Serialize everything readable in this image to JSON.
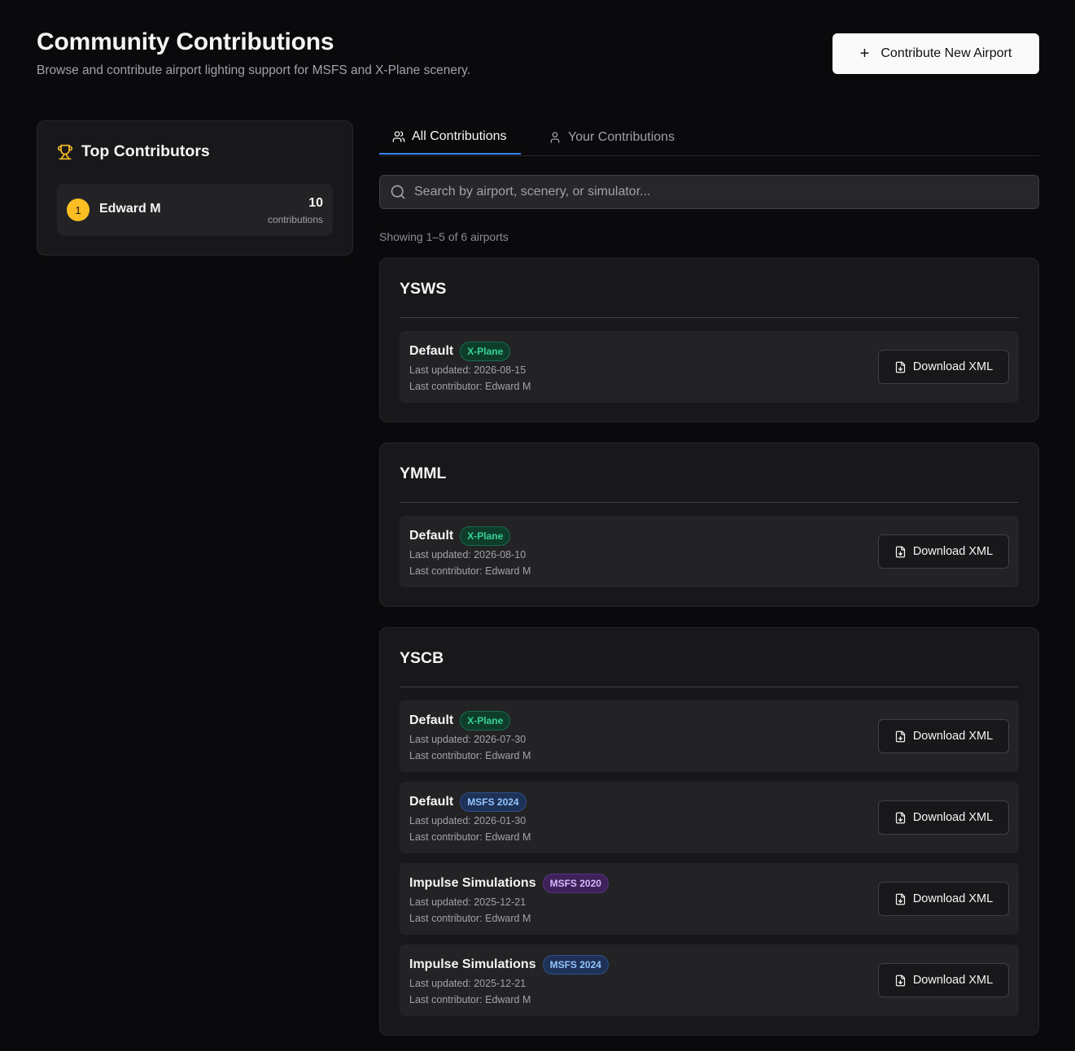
{
  "header": {
    "title": "Community Contributions",
    "subtitle": "Browse and contribute airport lighting support for MSFS and X-Plane scenery.",
    "contribute_label": "Contribute New Airport"
  },
  "sidebar": {
    "title": "Top Contributors",
    "contributors": [
      {
        "rank": "1",
        "name": "Edward M",
        "count": "10",
        "unit": "contributions"
      }
    ]
  },
  "tabs": [
    {
      "label": "All Contributions",
      "active": true
    },
    {
      "label": "Your Contributions",
      "active": false
    }
  ],
  "search": {
    "placeholder": "Search by airport, scenery, or simulator...",
    "value": ""
  },
  "showing_text": "Showing 1–5 of 6 airports",
  "colors": {
    "accent": "#3b82f6",
    "gold": "#fbbf24",
    "xplane": "#34d399",
    "msfs2024": "#93c5fd",
    "msfs2020": "#d8b4fe"
  },
  "airports": [
    {
      "code": "YSWS",
      "items": [
        {
          "name": "Default",
          "sim": "X-Plane",
          "sim_class": "xplane",
          "updated": "Last updated: 2026-08-15",
          "contributor": "Last contributor: Edward M",
          "download": "Download XML"
        }
      ]
    },
    {
      "code": "YMML",
      "items": [
        {
          "name": "Default",
          "sim": "X-Plane",
          "sim_class": "xplane",
          "updated": "Last updated: 2026-08-10",
          "contributor": "Last contributor: Edward M",
          "download": "Download XML"
        }
      ]
    },
    {
      "code": "YSCB",
      "items": [
        {
          "name": "Default",
          "sim": "X-Plane",
          "sim_class": "xplane",
          "updated": "Last updated: 2026-07-30",
          "contributor": "Last contributor: Edward M",
          "download": "Download XML"
        },
        {
          "name": "Default",
          "sim": "MSFS 2024",
          "sim_class": "msfs2024",
          "updated": "Last updated: 2026-01-30",
          "contributor": "Last contributor: Edward M",
          "download": "Download XML"
        },
        {
          "name": "Impulse Simulations",
          "sim": "MSFS 2020",
          "sim_class": "msfs2020",
          "updated": "Last updated: 2025-12-21",
          "contributor": "Last contributor: Edward M",
          "download": "Download XML"
        },
        {
          "name": "Impulse Simulations",
          "sim": "MSFS 2024",
          "sim_class": "msfs2024",
          "updated": "Last updated: 2025-12-21",
          "contributor": "Last contributor: Edward M",
          "download": "Download XML"
        }
      ]
    }
  ]
}
